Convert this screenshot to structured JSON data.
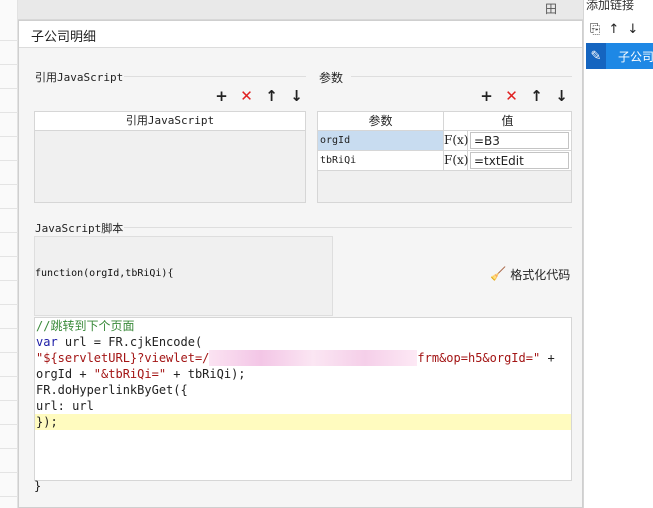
{
  "background": {
    "top_icon": "田"
  },
  "right_panel": {
    "title": "添加链接",
    "tools": [
      "copy-icon",
      "arrow-up-icon",
      "arrow-down-icon"
    ],
    "item_label": "子公司"
  },
  "dialog": {
    "title": "子公司明细",
    "js_ref": {
      "label": "引用JavaScript",
      "column": "引用JavaScript"
    },
    "params": {
      "label": "参数",
      "col_param": "参数",
      "col_value": "值",
      "rows": [
        {
          "name": "orgId",
          "fx": "F(x)",
          "value": "=B3"
        },
        {
          "name": "tbRiQi",
          "fx": "F(x)",
          "value": "=txtEdit"
        }
      ]
    },
    "script": {
      "label": "JavaScript脚本",
      "signature": "function(orgId,tbRiQi){",
      "format_button": "格式化代码",
      "closing": "}"
    },
    "code": {
      "comment": "//跳转到下个页面",
      "l2_kw": "var",
      "l2_rest": " url = FR.cjkEncode(",
      "l3_a": "\"${servletURL}?viewlet=/",
      "l3_b": "frm&op=h5&orgId=\"",
      "l3_c": " +",
      "l4_a": "orgId + ",
      "l4_b": "\"&tbRiQi=\"",
      "l4_c": " + tbRiQi);",
      "l5": "FR.doHyperlinkByGet({",
      "l6": "     url: url",
      "l7": "});"
    },
    "toolbar": {
      "add": "+",
      "remove": "✕",
      "up": "🡑",
      "down": "🡓"
    }
  }
}
